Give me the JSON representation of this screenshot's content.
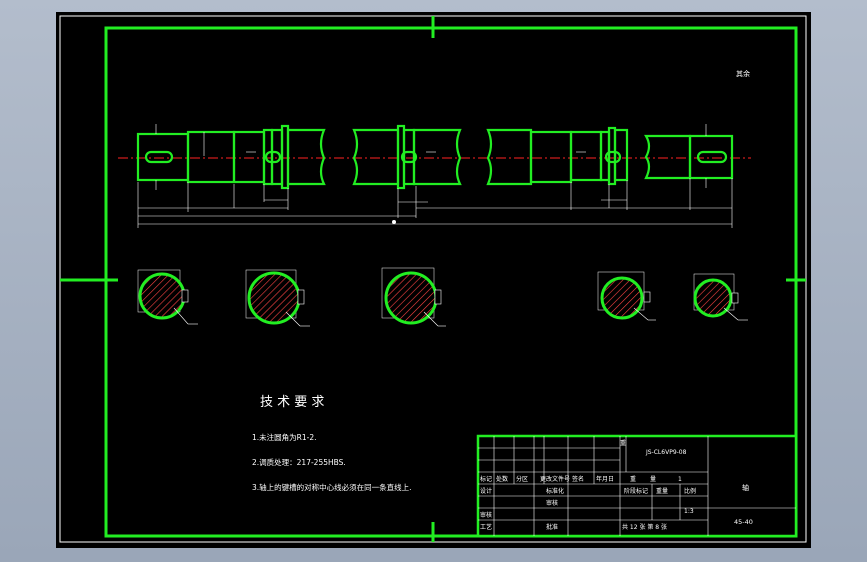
{
  "drawing": {
    "scale_note": "其余",
    "tech_title": "技 术 要 求",
    "tech_req": [
      "1.未注圆角为R1-2.",
      "2.调质处理：217-255HBS.",
      "3.轴上的键槽的对称中心线必须在同一条直线上."
    ]
  },
  "title_block": {
    "doc_number": "JS-CL6VP9-08",
    "part_name": "轴",
    "material": "45-40",
    "scale": "1:3",
    "header_labels": [
      "标记",
      "处数",
      "分区",
      "更改文件号",
      "签名",
      "年月日"
    ],
    "row_labels": [
      "设计",
      "审核",
      "工艺"
    ],
    "std_labels": [
      "标准化",
      "审核",
      "批准"
    ],
    "stage_label": "阶段标记",
    "weight_label": "重量",
    "ratio_label": "比例",
    "sheets_text": "共 12 张 第 8 张",
    "row1_labels": [
      "重",
      "量"
    ],
    "row1_note": "1"
  }
}
